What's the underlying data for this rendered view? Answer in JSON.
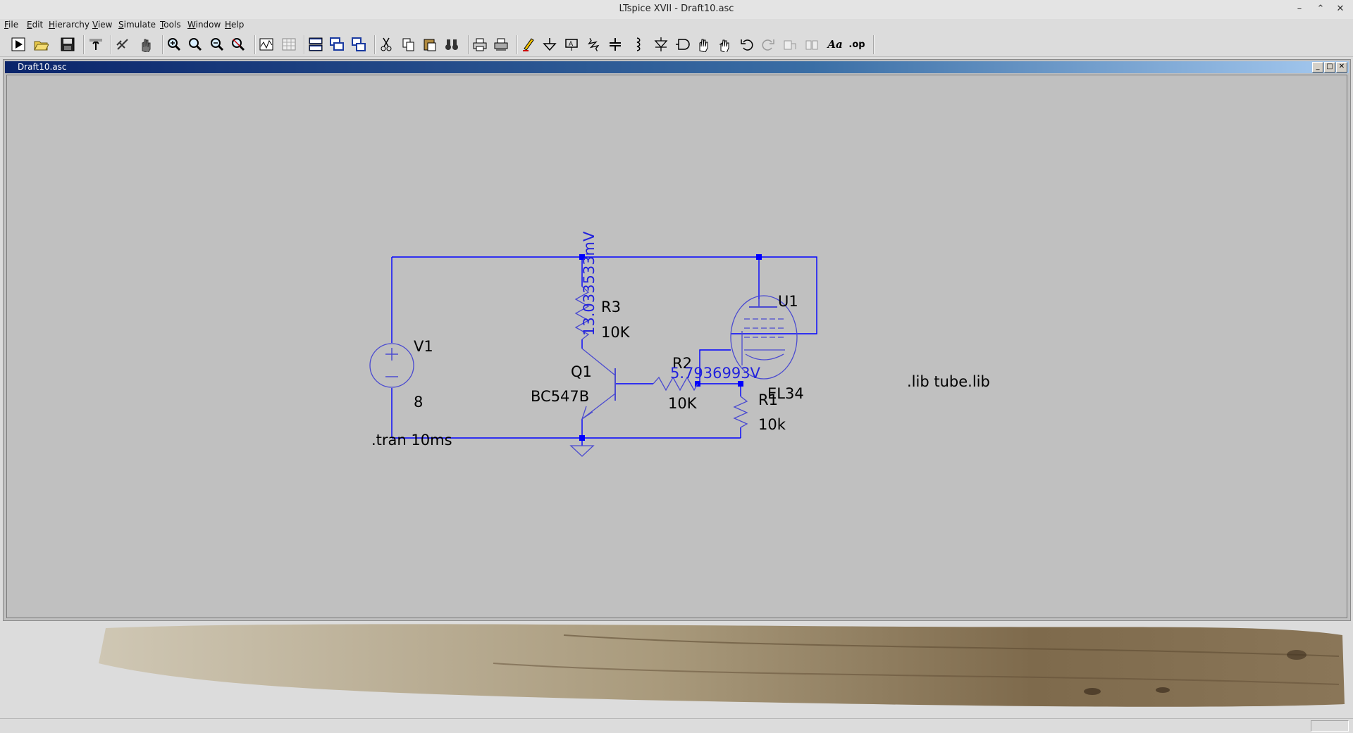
{
  "window": {
    "title": "LTspice XVII - Draft10.asc"
  },
  "menu": [
    "File",
    "Edit",
    "Hierarchy",
    "View",
    "Simulate",
    "Tools",
    "Window",
    "Help"
  ],
  "document": {
    "title": "Draft10.asc"
  },
  "schematic": {
    "v1": {
      "name": "V1",
      "value": "8"
    },
    "r3": {
      "name": "R3",
      "value": "10K"
    },
    "r2": {
      "name": "R2",
      "value": "10K"
    },
    "r1": {
      "name": "R1",
      "value": "10k"
    },
    "q1": {
      "name": "Q1",
      "model": "BC547B"
    },
    "u1": {
      "name": "U1",
      "model": "EL34"
    },
    "probe_r3": "13.033533mV",
    "probe_r2": "5.7936993V",
    "directive_tran": ".tran 10ms",
    "directive_lib": ".lib tube.lib"
  },
  "colors": {
    "wire": "#0000ff",
    "component": "#4a4ad0",
    "probe_text": "#2222dd",
    "canvas": "#c0c0c0"
  }
}
